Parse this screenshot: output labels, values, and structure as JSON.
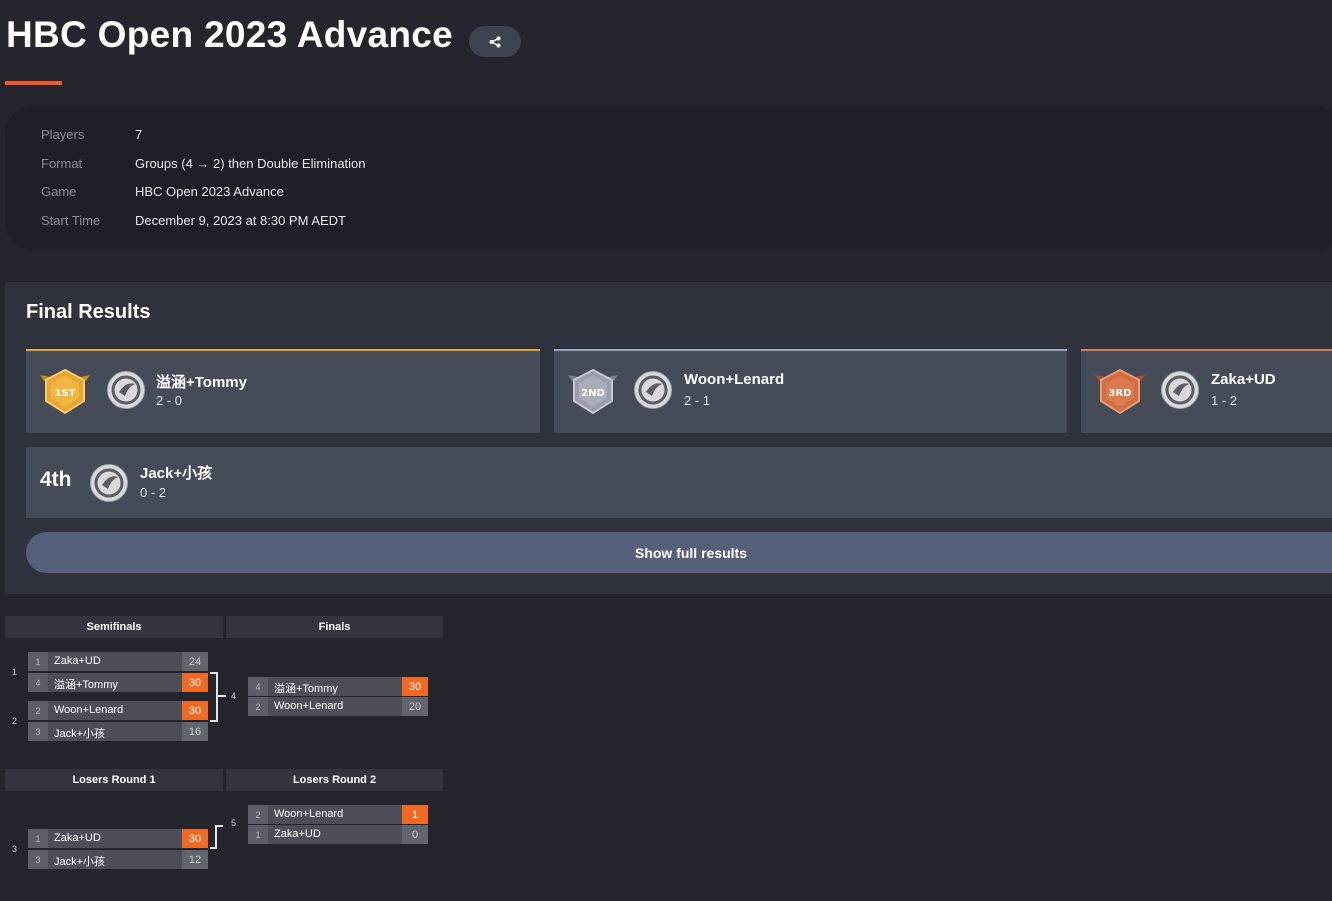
{
  "page": {
    "title": "HBC Open 2023 Advance",
    "share_icon": "share-icon",
    "accent_color": "#ef5a24"
  },
  "info": [
    {
      "label": "Players",
      "value": "7"
    },
    {
      "label": "Format",
      "value": "Groups (4 → 2) then Double Elimination"
    },
    {
      "label": "Game",
      "value": "HBC Open 2023 Advance"
    },
    {
      "label": "Start Time",
      "value": "December 9, 2023 at 8:30 PM AEDT"
    }
  ],
  "results": {
    "heading": "Final Results",
    "podium": [
      {
        "badge": "1ST",
        "team": "溢涵+Tommy",
        "record": "2 - 0",
        "color": "#e8a531"
      },
      {
        "badge": "2ND",
        "team": "Woon+Lenard",
        "record": "2 - 1",
        "color": "#9da4c8"
      },
      {
        "badge": "3RD",
        "team": "Zaka+UD",
        "record": "1 - 2",
        "color": "#e07a4e"
      }
    ],
    "fourth": {
      "place": "4th",
      "team": "Jack+小孩",
      "record": "0 - 2"
    },
    "show_full_label": "Show full results"
  },
  "bracket": {
    "winners_headers": [
      "Semifinals",
      "Finals"
    ],
    "losers_headers": [
      "Losers Round 1",
      "Losers Round 2"
    ],
    "winners_semis": [
      {
        "num": "1",
        "rows": [
          {
            "seed": "1",
            "name": "Zaka+UD",
            "score": "24",
            "win": false
          },
          {
            "seed": "4",
            "name": "溢涵+Tommy",
            "score": "30",
            "win": true
          }
        ]
      },
      {
        "num": "2",
        "rows": [
          {
            "seed": "2",
            "name": "Woon+Lenard",
            "score": "30",
            "win": true
          },
          {
            "seed": "3",
            "name": "Jack+小孩",
            "score": "16",
            "win": false
          }
        ]
      }
    ],
    "winners_final": {
      "num": "4",
      "rows": [
        {
          "seed": "4",
          "name": "溢涵+Tommy",
          "score": "30",
          "win": true
        },
        {
          "seed": "2",
          "name": "Woon+Lenard",
          "score": "20",
          "win": false
        }
      ]
    },
    "losers_r1": {
      "num": "3",
      "rows": [
        {
          "seed": "1",
          "name": "Zaka+UD",
          "score": "30",
          "win": true
        },
        {
          "seed": "3",
          "name": "Jack+小孩",
          "score": "12",
          "win": false
        }
      ]
    },
    "losers_r2": {
      "num": "5",
      "rows": [
        {
          "seed": "2",
          "name": "Woon+Lenard",
          "score": "1",
          "win": true
        },
        {
          "seed": "1",
          "name": "Zaka+UD",
          "score": "0",
          "win": false
        }
      ]
    }
  }
}
